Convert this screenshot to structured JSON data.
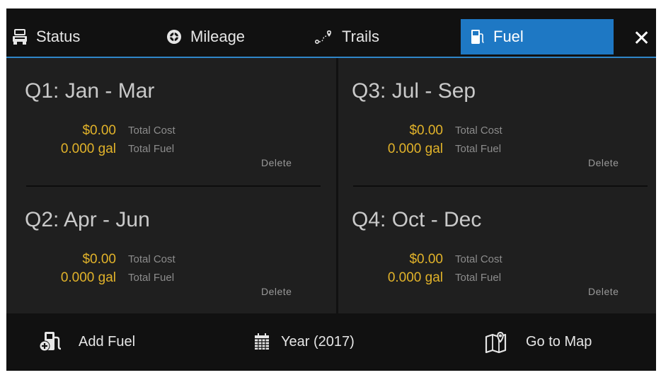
{
  "tabs": {
    "status": {
      "label": "Status",
      "icon": "truck-icon"
    },
    "mileage": {
      "label": "Mileage",
      "icon": "tire-icon"
    },
    "trails": {
      "label": "Trails",
      "icon": "route-icon"
    },
    "fuel": {
      "label": "Fuel",
      "icon": "fuel-pump-icon",
      "active": true
    }
  },
  "close_icon": "close-icon",
  "quarters": [
    {
      "title": "Q1: Jan - Mar",
      "cost_value": "$0.00",
      "cost_label": "Total Cost",
      "fuel_value": "0.000 gal",
      "fuel_label": "Total Fuel",
      "delete_label": "Delete"
    },
    {
      "title": "Q2: Apr - Jun",
      "cost_value": "$0.00",
      "cost_label": "Total Cost",
      "fuel_value": "0.000 gal",
      "fuel_label": "Total Fuel",
      "delete_label": "Delete"
    },
    {
      "title": "Q3: Jul - Sep",
      "cost_value": "$0.00",
      "cost_label": "Total Cost",
      "fuel_value": "0.000 gal",
      "fuel_label": "Total Fuel",
      "delete_label": "Delete"
    },
    {
      "title": "Q4: Oct - Dec",
      "cost_value": "$0.00",
      "cost_label": "Total Cost",
      "fuel_value": "0.000 gal",
      "fuel_label": "Total Fuel",
      "delete_label": "Delete"
    }
  ],
  "bottom": {
    "add_fuel": {
      "label": "Add Fuel",
      "icon": "add-fuel-icon"
    },
    "year": {
      "label": "Year (2017)",
      "icon": "calendar-icon"
    },
    "map": {
      "label": "Go to Map",
      "icon": "map-icon"
    }
  },
  "colors": {
    "accent": "#1e78c4",
    "value": "#e2b32a",
    "background": "#1f1f1f",
    "bar": "#111111"
  }
}
